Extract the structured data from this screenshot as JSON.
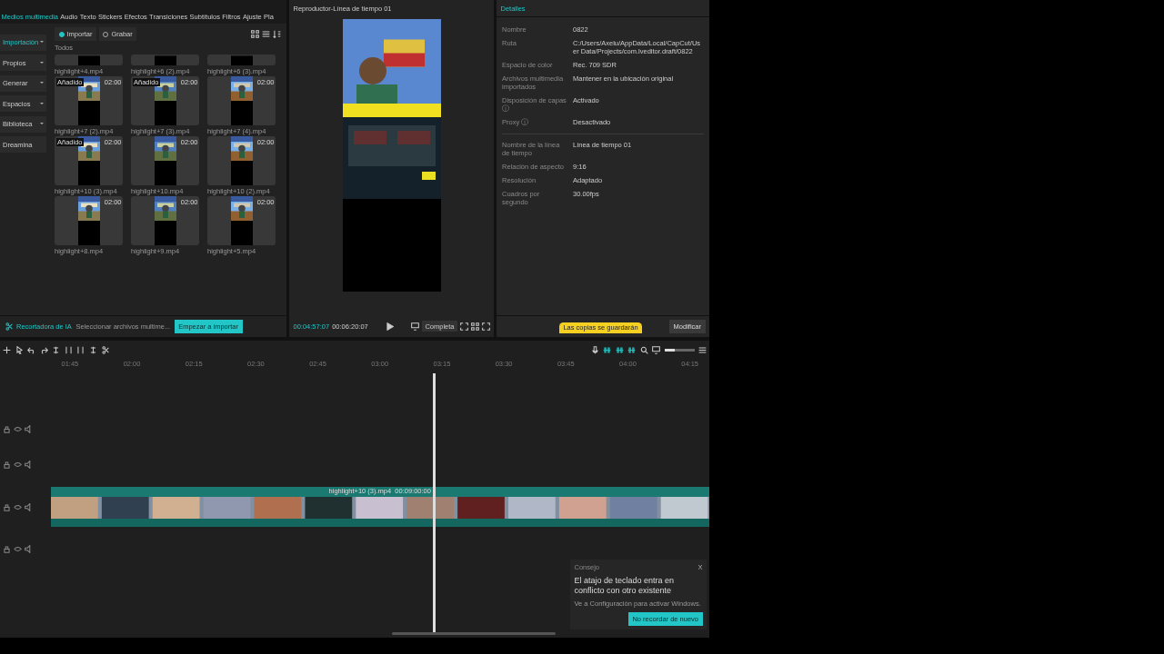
{
  "menu_tabs": [
    {
      "label": "Medios multimedia",
      "selected": true
    },
    {
      "label": "Audio",
      "selected": false
    },
    {
      "label": "Texto",
      "selected": false
    },
    {
      "label": "Stickers",
      "selected": false
    },
    {
      "label": "Efectos",
      "selected": false
    },
    {
      "label": "Transiciones",
      "selected": false
    },
    {
      "label": "Subtítulos",
      "selected": false
    },
    {
      "label": "Filtros",
      "selected": false
    },
    {
      "label": "Ajuste",
      "selected": false
    },
    {
      "label": "Pla",
      "selected": false
    }
  ],
  "sidebar": {
    "items": [
      {
        "label": "Importación",
        "selected": true,
        "kind": "dropdown"
      },
      {
        "label": "Propios",
        "selected": false,
        "kind": "dropdown"
      },
      {
        "label": "Generar",
        "selected": false,
        "kind": "dropdown"
      },
      {
        "label": "Espacios",
        "selected": false,
        "kind": "dropdown"
      },
      {
        "label": "Biblioteca",
        "selected": false,
        "kind": "dropdown"
      },
      {
        "label": "Dreamina",
        "selected": false,
        "kind": "plain"
      }
    ]
  },
  "media": {
    "modes": [
      {
        "label": "Importar",
        "selected": true
      },
      {
        "label": "Grabar",
        "selected": false
      }
    ],
    "filter": "Todos",
    "items": [
      {
        "name": "highlight+4.mp4",
        "kind": "cut"
      },
      {
        "name": "highlight+6 (2).mp4",
        "kind": "cut"
      },
      {
        "name": "highlight+6 (3).mp4",
        "kind": "cut"
      },
      {
        "name": "highlight+7 (2).mp4",
        "kind": "full",
        "duration": "02:00",
        "badge": "Añadido"
      },
      {
        "name": "highlight+7 (3).mp4",
        "kind": "full",
        "duration": "02:00",
        "badge": "Añadido"
      },
      {
        "name": "highlight+7 (4).mp4",
        "kind": "full",
        "duration": "02:00"
      },
      {
        "name": "highlight+10 (3).mp4",
        "kind": "full",
        "duration": "02:00",
        "badge": "Añadido"
      },
      {
        "name": "highlight+10.mp4",
        "kind": "full",
        "duration": "02:00"
      },
      {
        "name": "highlight+10 (2).mp4",
        "kind": "full",
        "duration": "02:00"
      },
      {
        "name": "highlight+8.mp4",
        "kind": "full",
        "duration": "02:00"
      },
      {
        "name": "highlight+9.mp4",
        "kind": "full",
        "duration": "02:00"
      },
      {
        "name": "highlight+5.mp4",
        "kind": "full",
        "duration": "02:00"
      }
    ]
  },
  "import_bar": {
    "tool": "Recortadora de IA",
    "hint": "Seleccionar archivos multime...",
    "button": "Empezar a importar"
  },
  "player": {
    "title": "Reproductor-Línea de tiempo 01",
    "current_time": "00:04:57:07",
    "total_time": "00:06:20:07",
    "ratio_button": "Completa"
  },
  "details": {
    "title": "Detalles",
    "groups": [
      [
        {
          "label": "Nombre",
          "value": "0822"
        },
        {
          "label": "Ruta",
          "value": "C:/Users/Axelu/AppData/Local/CapCut/User Data/Projects/com.lveditor.draft/0822"
        },
        {
          "label": "Espacio de color",
          "value": "Rec. 709 SDR"
        },
        {
          "label": "Archivos multimedia importados",
          "value": "Mantener en la ubicación original"
        },
        {
          "label": "Disposición de capas ⓘ",
          "value": "Activado"
        },
        {
          "label": "Proxy ⓘ",
          "value": "Desactivado"
        }
      ],
      [
        {
          "label": "Nombre de la línea de tiempo",
          "value": "Línea de tiempo 01"
        },
        {
          "label": "Relación de aspecto",
          "value": "9:16"
        },
        {
          "label": "Resolución",
          "value": "Adaptado"
        },
        {
          "label": "Cuadros por segundo",
          "value": "30.00fps"
        }
      ]
    ],
    "tooltip": "Las copias se guardarán",
    "button": "Modificar"
  },
  "timeline": {
    "ruler": [
      "01:45",
      "02:00",
      "02:15",
      "02:30",
      "02:45",
      "03:00",
      "03:15",
      "03:30",
      "03:45",
      "04:00",
      "04:15"
    ],
    "zoom": {
      "level": 0.35
    },
    "clip": {
      "name": "highlight+10 (3).mp4",
      "duration": "00:09:00:00"
    },
    "tracks": [
      {
        "kind": "empty"
      },
      {
        "kind": "empty"
      },
      {
        "kind": "video"
      },
      {
        "kind": "audio"
      }
    ]
  },
  "notification": {
    "title": "Consejo",
    "message": "El atajo de teclado entra en conflicto con otro existente",
    "note": "Ve a Configuración para activar Windows.",
    "button": "No recordar de nuevo",
    "close": "X"
  }
}
